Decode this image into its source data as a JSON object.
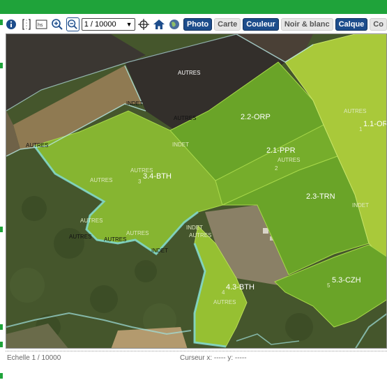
{
  "toolbar": {
    "scale_value": "1 / 10000",
    "buttons": {
      "photo": "Photo",
      "carte": "Carte",
      "couleur": "Couleur",
      "noir_blanc": "Noir & blanc",
      "calque": "Calque",
      "overflow": "Co"
    },
    "icons": [
      "info-icon",
      "bracket-icon",
      "hs-icon",
      "zoom-in-icon",
      "zoom-out-icon",
      "crosshair-icon",
      "home-icon",
      "globe-icon"
    ]
  },
  "map": {
    "parcels": [
      {
        "label": "1.1-OR",
        "number": "1"
      },
      {
        "label": "2.2-ORP"
      },
      {
        "label": "2.1-PPR",
        "number": "2"
      },
      {
        "label": "2.3-TRN"
      },
      {
        "label": "3.4-BTH",
        "number": "3"
      },
      {
        "label": "4.3-BTH",
        "number": "4"
      },
      {
        "label": "5.3-CZH",
        "number": "5"
      }
    ],
    "zone_labels": {
      "autres_top": "AUTRES",
      "autres_a": "AUTRES",
      "autres_b": "AUTRES",
      "autres_c": "AUTRES",
      "autres_d": "AUTRES",
      "autres_e": "AUTRES",
      "autres_f": "AUTRES",
      "autres_g": "AUTRES",
      "autres_h": "AUTRES",
      "autres_i": "AUTRES",
      "autres_j": "AUTRES",
      "autres_k": "AUTRES",
      "autres_l": "AUTRES",
      "indet_a": "INDET",
      "indet_b": "INDET",
      "indet_c": "INDET",
      "indet_d": "INDET",
      "indet_e": "INDET"
    },
    "colors": {
      "parcel_light": "#a9c93a",
      "parcel_mid": "#7fb32e",
      "parcel_dark": "#5c9a22",
      "boundary": "#7fd6d0",
      "forest": "#3f5229",
      "plowed": "#3a3530"
    }
  },
  "statusbar": {
    "echelle": "Echelle 1 / 10000",
    "curseur": "Curseur x: ----- y: -----"
  }
}
